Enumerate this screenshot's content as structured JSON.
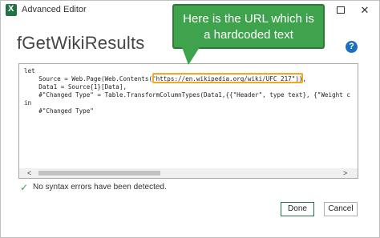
{
  "window": {
    "title": "Advanced Editor",
    "controls": {
      "minimize": "–",
      "maximize": "□",
      "close": "✕"
    }
  },
  "query": {
    "name": "fGetWikiResults"
  },
  "help": {
    "label": "?"
  },
  "callout": {
    "line1": "Here is the URL which is",
    "line2": "a hardcoded text"
  },
  "editor": {
    "lines": [
      "let",
      "    Source = Web.Page(Web.Contents(\"https://en.wikipedia.org/wiki/UFC_217\")),",
      "    Data1 = Source{1}[Data],",
      "    #\"Changed Type\" = Table.TransformColumnTypes(Data1,{{\"Header\", type text}, {\"Weight c",
      "in",
      "    #\"Changed Type\""
    ],
    "scroll_left": "<",
    "scroll_right": ">"
  },
  "status": {
    "icon": "check-icon",
    "text": "No syntax errors have been detected."
  },
  "buttons": {
    "done": "Done",
    "cancel": "Cancel"
  }
}
